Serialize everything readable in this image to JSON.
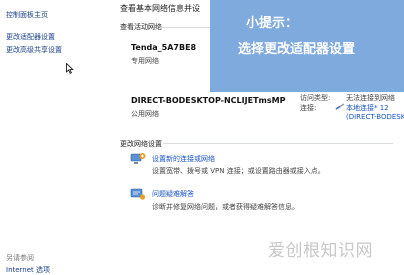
{
  "sidebar": {
    "home": "控制面板主页",
    "links": [
      "更改适配器设置",
      "更改高级共享设置"
    ],
    "see_also": "另请参阅",
    "bottom_item": "Internet 选项"
  },
  "main": {
    "header_cut": "查看基本网络信息并设",
    "active_networks_title": "查看活动网络",
    "networks": [
      {
        "name": "Tenda_5A7BE8",
        "type": "专用网络"
      },
      {
        "name": "DIRECT-BODESKTOP-NCLIJETmsMP",
        "type": "公用网络"
      }
    ],
    "access_type_label": "访问类型:",
    "access_type_value": "无法连接到网络",
    "connection_label": "连接:",
    "connection_value": "本地连接* 12",
    "connection_value_2": "(DIRECT-BODESK",
    "change_settings_title": "更改网络设置",
    "tasks": [
      {
        "title": "设置新的连接或网络",
        "desc": "设置宽带、拨号或 VPN 连接；或设置路由器或接入点。"
      },
      {
        "title": "问题疑难解答",
        "desc": "诊断并修复网络问题，或者获得疑难解答信息。"
      }
    ]
  },
  "overlay": {
    "title": "小提示：",
    "text": "选择更改适配器设置"
  },
  "watermark": "爱创根知识网",
  "colors": {
    "overlay": "#7aa7dc",
    "link": "#1a55c5",
    "nav": "#1a3f8a"
  }
}
